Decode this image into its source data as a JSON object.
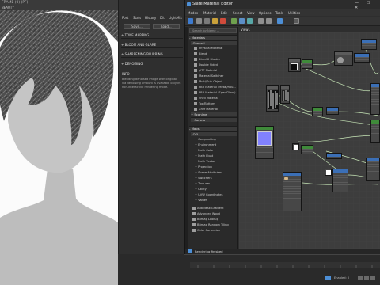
{
  "render_window": {
    "title": "FRAME (0) (PF)",
    "preset_label": "BEAUTY"
  },
  "render_panel": {
    "tabs": [
      "Post",
      "Stats",
      "History",
      "Dlt",
      "LightMix"
    ],
    "buttons": [
      "Save...",
      "Load..."
    ],
    "sections": [
      "TONE MAPPING",
      "BLOOM AND GLARE",
      "SHARPENING/BLURRING",
      "DENOISING",
      "INFO"
    ],
    "info_text": "Blending denoised image with original via denoising amount is available only in non-interactive rendering mode."
  },
  "slate": {
    "title": "Slate Material Editor",
    "window_buttons": "— ☐ ✕",
    "menu": [
      "Modes",
      "Material",
      "Edit",
      "Select",
      "View",
      "Options",
      "Tools",
      "Utilities"
    ],
    "view_tab": "View1",
    "search_placeholder": "Search by Name ...",
    "browser": {
      "materials_header": "- Materials",
      "general_header": "- General",
      "general_items": [
        "Physical Material",
        "Blend",
        "DirectX Shader",
        "Double Sided",
        "glTF Material",
        "Material Switcher",
        "Multi/Sub-Object",
        "PBR Material (Metal/Rou...",
        "PBR Material (Spec/Gloss)",
        "Shell Material",
        "Top/Bottom",
        "XRef Material"
      ],
      "scanline_header": "+ Scanline",
      "corona_header": "+ Corona",
      "maps_header": "- Maps",
      "osl_header": "- OSL",
      "osl_items": [
        "+ Compositing",
        "+ Environment",
        "+ Math Color",
        "+ Math Float",
        "+ Math Vector",
        "+ Projection",
        "+ Scene Attributes",
        "+ Switchers",
        "+ Textures",
        "+ Utility",
        "+ UVW Coordinates",
        "+ Values"
      ],
      "extra_items": [
        "Autodesk Gradient",
        "Advanced Wood",
        "Bitmap Lookup",
        "Bitmap Random Tiling",
        "Color Correction"
      ]
    },
    "status": "Rendering finished",
    "timeline_status": "Enabled: 0"
  },
  "colors": {
    "node_blue": "#3b6fb6",
    "node_green": "#3f8a3a",
    "node_gray": "#5b5b5b",
    "wire": "#c8e7b8",
    "accent": "#4d8fd6"
  }
}
